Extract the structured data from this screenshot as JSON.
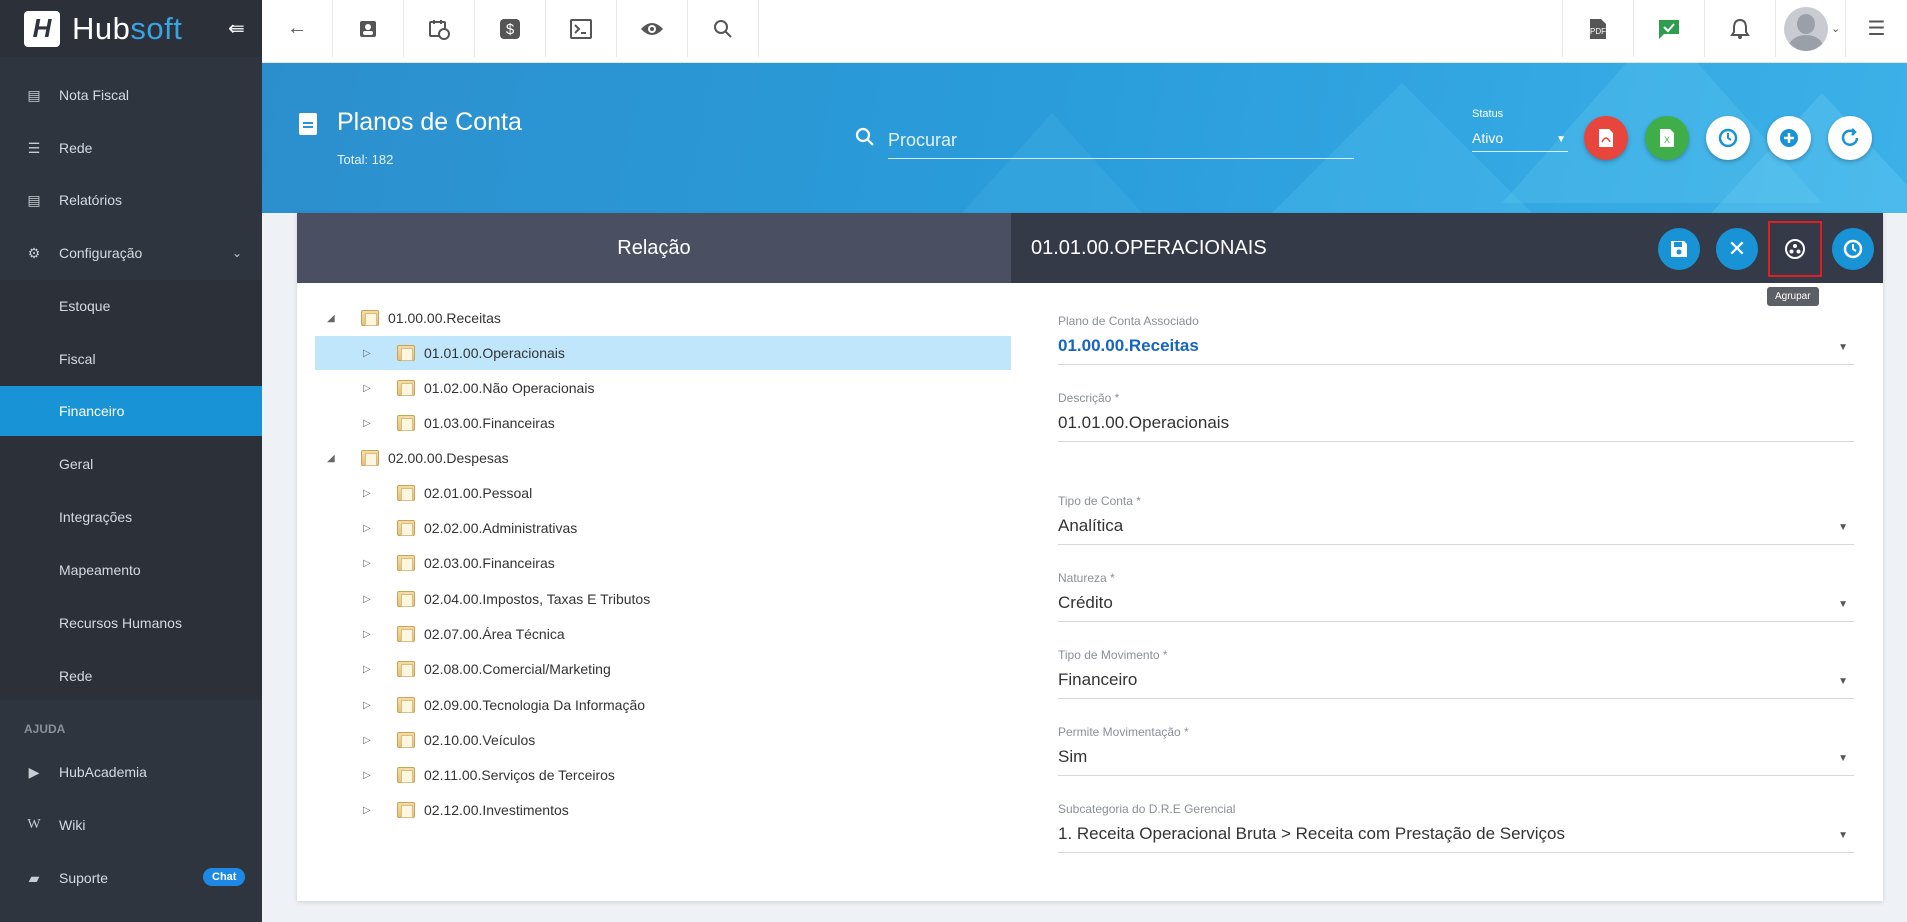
{
  "brand": {
    "name_part1": "Hub",
    "name_part2": "soft",
    "logo_letter": "H"
  },
  "sidebar": {
    "items": [
      {
        "label": "Nota Fiscal",
        "icon": "document-icon"
      },
      {
        "label": "Rede",
        "icon": "server-icon"
      },
      {
        "label": "Relatórios",
        "icon": "report-icon"
      },
      {
        "label": "Configuração",
        "icon": "gear-icon"
      },
      {
        "label": "Estoque"
      },
      {
        "label": "Fiscal"
      },
      {
        "label": "Financeiro"
      },
      {
        "label": "Geral"
      },
      {
        "label": "Integrações"
      },
      {
        "label": "Mapeamento"
      },
      {
        "label": "Recursos Humanos"
      },
      {
        "label": "Rede"
      }
    ],
    "section_help": "AJUDA",
    "help_items": [
      {
        "label": "HubAcademia",
        "icon": "youtube-icon"
      },
      {
        "label": "Wiki",
        "icon": "wikipedia-icon"
      },
      {
        "label": "Suporte",
        "icon": "chat-icon",
        "badge": "Chat"
      }
    ],
    "active_color": "#1793d6"
  },
  "header": {
    "title": "Planos de Conta",
    "total": "Total: 182",
    "search_placeholder": "Procurar",
    "status_label": "Status",
    "status_value": "Ativo"
  },
  "card": {
    "left_title": "Relação",
    "right_title": "01.01.00.OPERACIONAIS",
    "tooltip": "Agrupar"
  },
  "tree": [
    {
      "label": "01.00.00.Receitas",
      "level": 0,
      "expanded": true
    },
    {
      "label": "01.01.00.Operacionais",
      "level": 1,
      "selected": true
    },
    {
      "label": "01.02.00.Não Operacionais",
      "level": 1
    },
    {
      "label": "01.03.00.Financeiras",
      "level": 1
    },
    {
      "label": "02.00.00.Despesas",
      "level": 0,
      "expanded": true
    },
    {
      "label": "02.01.00.Pessoal",
      "level": 1
    },
    {
      "label": "02.02.00.Administrativas",
      "level": 1
    },
    {
      "label": "02.03.00.Financeiras",
      "level": 1
    },
    {
      "label": "02.04.00.Impostos, Taxas E Tributos",
      "level": 1
    },
    {
      "label": "02.07.00.Área Técnica",
      "level": 1
    },
    {
      "label": "02.08.00.Comercial/Marketing",
      "level": 1
    },
    {
      "label": "02.09.00.Tecnologia Da Informação",
      "level": 1
    },
    {
      "label": "02.10.00.Veículos",
      "level": 1
    },
    {
      "label": "02.11.00.Serviços de Terceiros",
      "level": 1
    },
    {
      "label": "02.12.00.Investimentos",
      "level": 1
    }
  ],
  "form": {
    "plano_associado": {
      "label": "Plano de Conta Associado",
      "value": "01.00.00.Receitas"
    },
    "descricao": {
      "label": "Descrição *",
      "value": "01.01.00.Operacionais"
    },
    "tipo_conta": {
      "label": "Tipo de Conta *",
      "value": "Analítica"
    },
    "natureza": {
      "label": "Natureza *",
      "value": "Crédito"
    },
    "tipo_movimento": {
      "label": "Tipo de Movimento *",
      "value": "Financeiro"
    },
    "permite_movimentacao": {
      "label": "Permite Movimentação *",
      "value": "Sim"
    },
    "subcategoria": {
      "label": "Subcategoria do D.R.E Gerencial",
      "value": "1. Receita Operacional Bruta > Receita com Prestação de Serviços"
    }
  }
}
